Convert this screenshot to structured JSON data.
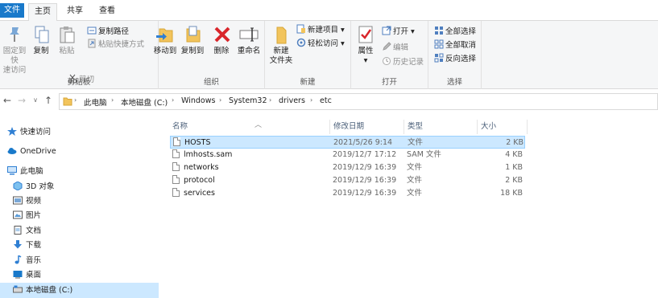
{
  "tabs": {
    "file": "文件",
    "home": "主页",
    "share": "共享",
    "view": "查看"
  },
  "ribbon": {
    "clipboard": {
      "pin": "固定到快速访问",
      "pin_line1": "固定到快",
      "pin_line2": "速访问",
      "copy": "复制",
      "paste": "粘贴",
      "cut": "剪切",
      "copy_path": "复制路径",
      "paste_shortcut": "粘贴快捷方式",
      "label": "剪贴板"
    },
    "organize": {
      "move_to": "移动到",
      "copy_to": "复制到",
      "delete": "删除",
      "rename": "重命名",
      "label": "组织"
    },
    "new": {
      "new_folder_line1": "新建",
      "new_folder_line2": "文件夹",
      "new_item": "新建项目",
      "easy_access": "轻松访问",
      "label": "新建"
    },
    "open": {
      "properties": "属性",
      "open": "打开",
      "edit": "编辑",
      "history": "历史记录",
      "label": "打开"
    },
    "select": {
      "select_all": "全部选择",
      "select_none": "全部取消",
      "invert": "反向选择",
      "label": "选择"
    }
  },
  "breadcrumb": [
    "此电脑",
    "本地磁盘 (C:)",
    "Windows",
    "System32",
    "drivers",
    "etc"
  ],
  "navpane": {
    "quick_access": "快速访问",
    "onedrive": "OneDrive",
    "this_pc": "此电脑",
    "objects3d": "3D 对象",
    "videos": "视频",
    "pictures": "图片",
    "documents": "文档",
    "downloads": "下载",
    "music": "音乐",
    "desktop": "桌面",
    "local_disk": "本地磁盘 (C:)"
  },
  "columns": {
    "name": "名称",
    "date": "修改日期",
    "type": "类型",
    "size": "大小"
  },
  "files": [
    {
      "name": "HOSTS",
      "date": "2021/5/26 9:14",
      "type": "文件",
      "size": "2 KB"
    },
    {
      "name": "lmhosts.sam",
      "date": "2019/12/7 17:12",
      "type": "SAM 文件",
      "size": "4 KB"
    },
    {
      "name": "networks",
      "date": "2019/12/9 16:39",
      "type": "文件",
      "size": "1 KB"
    },
    {
      "name": "protocol",
      "date": "2019/12/9 16:39",
      "type": "文件",
      "size": "2 KB"
    },
    {
      "name": "services",
      "date": "2019/12/9 16:39",
      "type": "文件",
      "size": "18 KB"
    }
  ],
  "colors": {
    "accent": "#1979ca",
    "selection": "#cce8ff",
    "folder": "#f2c45c"
  }
}
